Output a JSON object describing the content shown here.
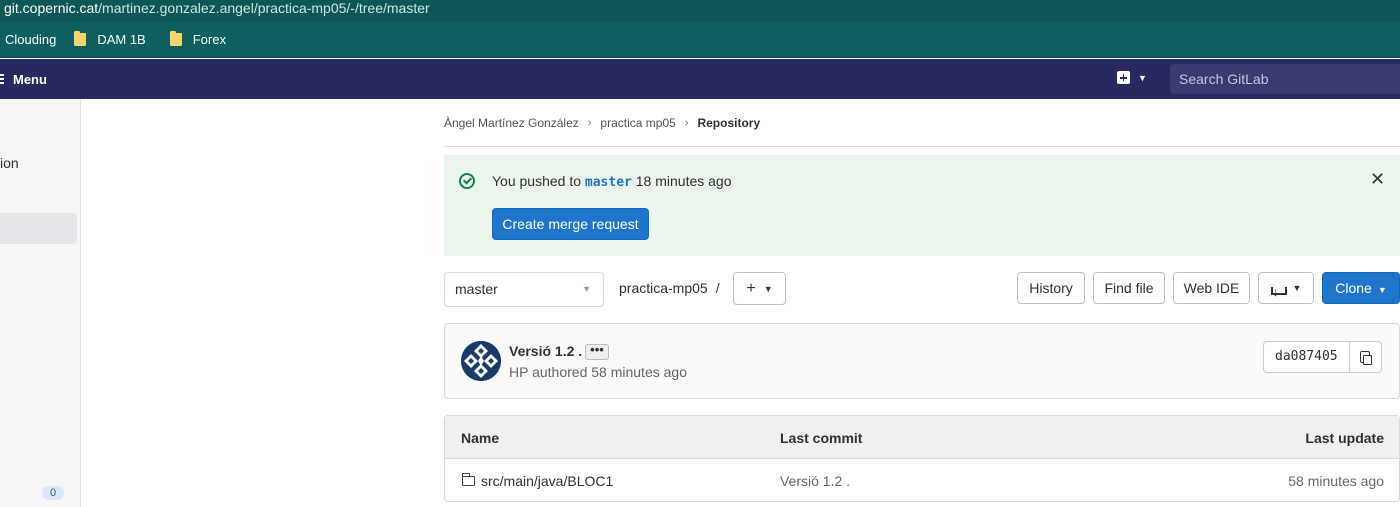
{
  "browser": {
    "url_host": "git.copernic.cat",
    "url_path": "/martinez.gonzalez.angel/practica-mp05/-/tree/master",
    "bookmarks": [
      {
        "label": "Clouding"
      },
      {
        "label": "DAM 1B"
      },
      {
        "label": "Forex"
      }
    ]
  },
  "topnav": {
    "menu_label": "Menu",
    "search_placeholder": "Search GitLab"
  },
  "sidebar": {
    "partial_label": "ion",
    "badge_count": "0"
  },
  "breadcrumb": {
    "items": [
      "Àngel Martínez González",
      "practica mp05",
      "Repository"
    ]
  },
  "alert": {
    "prefix": "You pushed to",
    "branch": "master",
    "suffix": "18 minutes ago",
    "button_label": "Create merge request",
    "close_glyph": "✕"
  },
  "tree": {
    "branch": "master",
    "repo_path": "practica-mp05",
    "path_separator": "/",
    "buttons": {
      "history": "History",
      "find_file": "Find file",
      "web_ide": "Web IDE",
      "clone": "Clone"
    }
  },
  "commit": {
    "title": "Versió 1.2 .",
    "ellipsis": "•••",
    "meta": "HP authored 58 minutes ago",
    "sha": "da087405"
  },
  "files": {
    "headers": {
      "name": "Name",
      "last_commit": "Last commit",
      "last_update": "Last update"
    },
    "rows": [
      {
        "name": "src/main/java/BLOC1",
        "last_commit": "Versió 1.2 .",
        "last_update": "58 minutes ago"
      }
    ]
  },
  "colors": {
    "accent": "#1f75cb",
    "topnav": "#292961",
    "alert_bg": "#ecf4ee",
    "success": "#108548"
  },
  "icons": [
    "folder-icon",
    "hamburger-icon",
    "plus-square-icon",
    "chevron-down-icon",
    "check-circle-icon",
    "close-icon",
    "plus-icon",
    "download-icon",
    "copy-icon",
    "directory-icon",
    "avatar"
  ]
}
